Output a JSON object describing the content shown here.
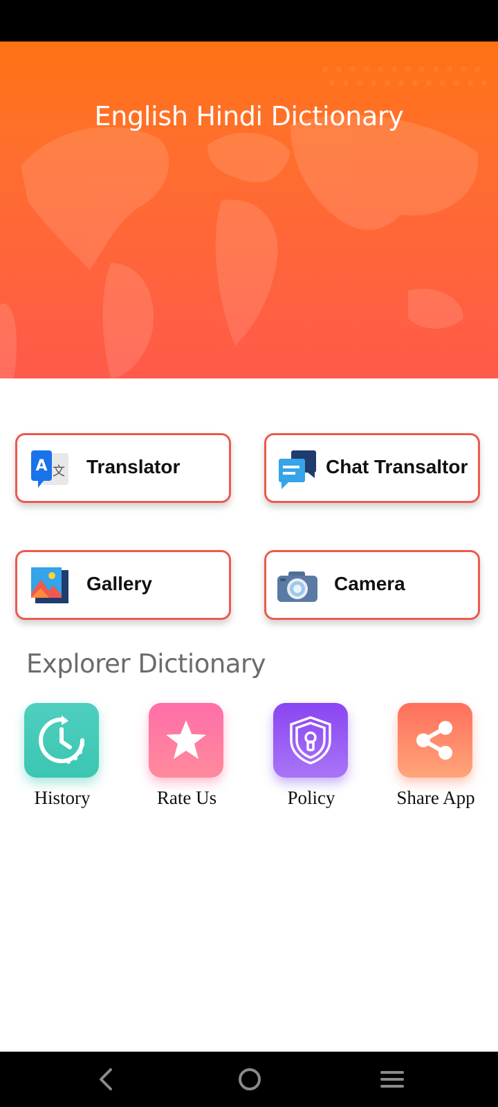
{
  "app": {
    "title": "English Hindi Dictionary"
  },
  "features": [
    {
      "label": "Translator",
      "icon": "translate-icon"
    },
    {
      "label": "Chat Transaltor",
      "icon": "chat-icon"
    },
    {
      "label": "Gallery",
      "icon": "gallery-icon"
    },
    {
      "label": "Camera",
      "icon": "camera-icon"
    }
  ],
  "explorer": {
    "title": "Explorer Dictionary",
    "items": [
      {
        "label": "History",
        "icon": "history-icon",
        "color": "#45ccb9"
      },
      {
        "label": "Rate Us",
        "icon": "star-icon",
        "color": "#ff7aa0"
      },
      {
        "label": "Policy",
        "icon": "shield-lock-icon",
        "color": "#8b5cf6"
      },
      {
        "label": "Share App",
        "icon": "share-icon",
        "color": "#ff8a6a"
      }
    ]
  },
  "colors": {
    "header_top": "#ff7213",
    "header_bottom": "#ff5a4a",
    "accent_border": "#ec5a4d"
  },
  "nav": {
    "back": "back-icon",
    "home": "home-icon",
    "menu": "menu-icon"
  }
}
